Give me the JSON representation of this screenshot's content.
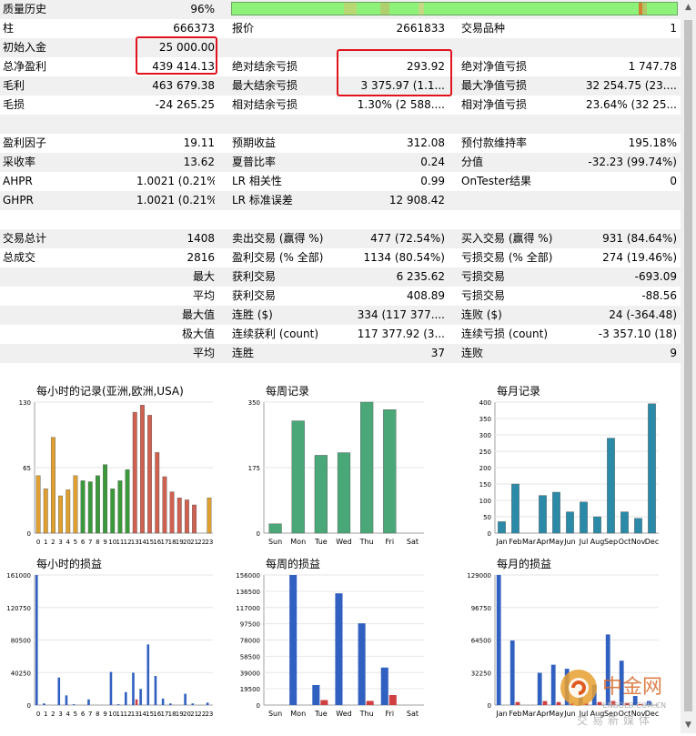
{
  "stats": {
    "quality_label": "质量历史",
    "quality_value": "96%",
    "rows": [
      {
        "c": [
          "柱",
          "666373",
          "报价",
          "2661833",
          "交易品种",
          "1"
        ]
      },
      {
        "c": [
          "初始入金",
          "25 000.00",
          "",
          "",
          "",
          ""
        ]
      },
      {
        "c": [
          "总净盈利",
          "439 414.13",
          "绝对结余亏损",
          "293.92",
          "绝对净值亏损",
          "1 747.78"
        ]
      },
      {
        "c": [
          "毛利",
          "463 679.38",
          "最大结余亏损",
          "3 375.97 (1.1...",
          "最大净值亏损",
          "32 254.75 (23...."
        ]
      },
      {
        "c": [
          "毛损",
          "-24 265.25",
          "相对结余亏损",
          "1.30% (2 588....",
          "相对净值亏损",
          "23.64% (32 25..."
        ]
      },
      {
        "blank": true
      },
      {
        "c": [
          "盈利因子",
          "19.11",
          "预期收益",
          "312.08",
          "预付款维持率",
          "195.18%"
        ]
      },
      {
        "c": [
          "采收率",
          "13.62",
          "夏普比率",
          "0.24",
          "分值",
          "-32.23 (99.74%)"
        ]
      },
      {
        "c": [
          "AHPR",
          "1.0021 (0.21%)",
          "LR 相关性",
          "0.99",
          "OnTester结果",
          "0"
        ]
      },
      {
        "c": [
          "GHPR",
          "1.0021 (0.21%)",
          "LR 标准误差",
          "12 908.42",
          "",
          ""
        ]
      },
      {
        "blank": true
      },
      {
        "c": [
          "交易总计",
          "1408",
          "卖出交易 (赢得 %)",
          "477 (72.54%)",
          "买入交易 (赢得 %)",
          "931 (84.64%)"
        ]
      },
      {
        "c": [
          "总成交",
          "2816",
          "盈利交易 (% 全部)",
          "1134 (80.54%)",
          "亏损交易 (% 全部)",
          "274 (19.46%)"
        ]
      },
      {
        "c": [
          "",
          "最大",
          "获利交易",
          "6 235.62",
          "亏损交易",
          "-693.09"
        ]
      },
      {
        "c": [
          "",
          "平均",
          "获利交易",
          "408.89",
          "亏损交易",
          "-88.56"
        ]
      },
      {
        "c": [
          "",
          "最大值",
          "连胜 ($)",
          "334 (117 377....",
          "连败 ($)",
          "24 (-364.48)"
        ]
      },
      {
        "c": [
          "",
          "极大值",
          "连续获利 (count)",
          "117 377.92 (3...",
          "连续亏损 (count)",
          "-3 357.10 (18)"
        ]
      },
      {
        "c": [
          "",
          "平均",
          "连胜",
          "37",
          "连败",
          "9"
        ]
      }
    ]
  },
  "colors": {
    "accent_red": "#e0141e",
    "bar_green": "#8ef27a"
  },
  "charts": [
    {
      "title": "每小时的记录(亚洲,欧洲,USA)",
      "type": "bar",
      "ylim": [
        0,
        130
      ],
      "yticks": [
        "130",
        "65",
        "0"
      ],
      "categories": [
        "0",
        "1",
        "2",
        "3",
        "4",
        "5",
        "6",
        "7",
        "8",
        "9",
        "10",
        "11",
        "12",
        "13",
        "14",
        "15",
        "16",
        "17",
        "18",
        "19",
        "20",
        "21",
        "22",
        "23"
      ],
      "values": [
        57,
        44,
        95,
        37,
        43,
        57,
        52,
        51,
        57,
        68,
        44,
        52,
        63,
        120,
        127,
        117,
        80,
        56,
        41,
        35,
        33,
        28,
        0,
        35
      ],
      "colors": [
        "#e0a030",
        "#e0a030",
        "#e0a030",
        "#e0a030",
        "#e0a030",
        "#e0a030",
        "#3a9a3a",
        "#3a9a3a",
        "#3a9a3a",
        "#3a9a3a",
        "#3a9a3a",
        "#3a9a3a",
        "#3a9a3a",
        "#d06050",
        "#d06050",
        "#d06050",
        "#d06050",
        "#d06050",
        "#d06050",
        "#d06050",
        "#d06050",
        "#d06050",
        "#d06050",
        "#e0a030"
      ]
    },
    {
      "title": "每周记录",
      "type": "bar",
      "ylim": [
        0,
        350
      ],
      "yticks": [
        "350",
        "175",
        "0"
      ],
      "categories": [
        "Sun",
        "Mon",
        "Tue",
        "Wed",
        "Thu",
        "Fri",
        "Sat"
      ],
      "values": [
        25,
        300,
        208,
        215,
        350,
        330,
        0
      ],
      "colors": [
        "#4aa878",
        "#4aa878",
        "#4aa878",
        "#4aa878",
        "#4aa878",
        "#4aa878",
        "#4aa878"
      ]
    },
    {
      "title": "每月记录",
      "type": "bar",
      "ylim": [
        0,
        400
      ],
      "yticks": [
        "400",
        "350",
        "300",
        "250",
        "200",
        "150",
        "100",
        "50",
        "0"
      ],
      "categories": [
        "Jan",
        "Feb",
        "Mar",
        "Apr",
        "May",
        "Jun",
        "Jul",
        "Aug",
        "Sep",
        "Oct",
        "Nov",
        "Dec"
      ],
      "values": [
        35,
        150,
        0,
        115,
        125,
        65,
        95,
        50,
        290,
        65,
        45,
        395
      ],
      "colors": [
        "#2a8aa8",
        "#2a8aa8",
        "#2a8aa8",
        "#2a8aa8",
        "#2a8aa8",
        "#2a8aa8",
        "#2a8aa8",
        "#2a8aa8",
        "#2a8aa8",
        "#2a8aa8",
        "#2a8aa8",
        "#2a8aa8"
      ]
    },
    {
      "title": "每小时的损益",
      "type": "bar",
      "ylim": [
        0,
        161000
      ],
      "yticks": [
        "161000",
        "120750",
        "80500",
        "40250",
        "0"
      ],
      "categories": [
        "0",
        "1",
        "2",
        "3",
        "4",
        "5",
        "6",
        "7",
        "8",
        "9",
        "10",
        "11",
        "12",
        "13",
        "14",
        "15",
        "16",
        "17",
        "18",
        "19",
        "20",
        "21",
        "22",
        "23"
      ],
      "series": [
        {
          "values": [
            161000,
            2000,
            0,
            34000,
            12000,
            1000,
            0,
            7000,
            0,
            0,
            41000,
            1000,
            16000,
            40000,
            20000,
            75000,
            36000,
            8000,
            2000,
            0,
            14000,
            2000,
            0,
            3000
          ],
          "color": "#3060c0"
        },
        {
          "values": [
            0,
            0,
            0,
            0,
            0,
            0,
            0,
            0,
            0,
            0,
            0,
            0,
            0,
            7000,
            0,
            0,
            0,
            0,
            0,
            0,
            0,
            0,
            0,
            0
          ],
          "color": "#d04040"
        }
      ]
    },
    {
      "title": "每周的损益",
      "type": "bar",
      "ylim": [
        0,
        156000
      ],
      "yticks": [
        "156000",
        "136500",
        "117000",
        "97500",
        "78000",
        "58500",
        "39000",
        "19500",
        "0"
      ],
      "categories": [
        "Sun",
        "Mon",
        "Tue",
        "Wed",
        "Thu",
        "Fri",
        "Sat"
      ],
      "series": [
        {
          "values": [
            0,
            156000,
            24000,
            134000,
            98000,
            45000,
            0
          ],
          "color": "#3060c0"
        },
        {
          "values": [
            0,
            0,
            6000,
            0,
            5000,
            12000,
            0
          ],
          "color": "#d04040"
        }
      ]
    },
    {
      "title": "每月的损益",
      "type": "bar",
      "ylim": [
        0,
        129000
      ],
      "yticks": [
        "129000",
        "96750",
        "64500",
        "32250",
        "0"
      ],
      "categories": [
        "Jan",
        "Feb",
        "Mar",
        "Apr",
        "May",
        "Jun",
        "Jul",
        "Aug",
        "Sep",
        "Oct",
        "Nov",
        "Dec"
      ],
      "series": [
        {
          "values": [
            129000,
            64000,
            0,
            32000,
            40000,
            36000,
            10000,
            20000,
            70000,
            44000,
            9000,
            4000
          ],
          "color": "#3060c0"
        },
        {
          "values": [
            0,
            3000,
            0,
            4000,
            3000,
            2000,
            2000,
            3000,
            4000,
            2000,
            1000,
            0
          ],
          "color": "#d04040"
        }
      ]
    }
  ],
  "watermark": {
    "brand": "中金网",
    "url": "CNGOLD.COM.CN",
    "tagline": "交易新媒体"
  }
}
